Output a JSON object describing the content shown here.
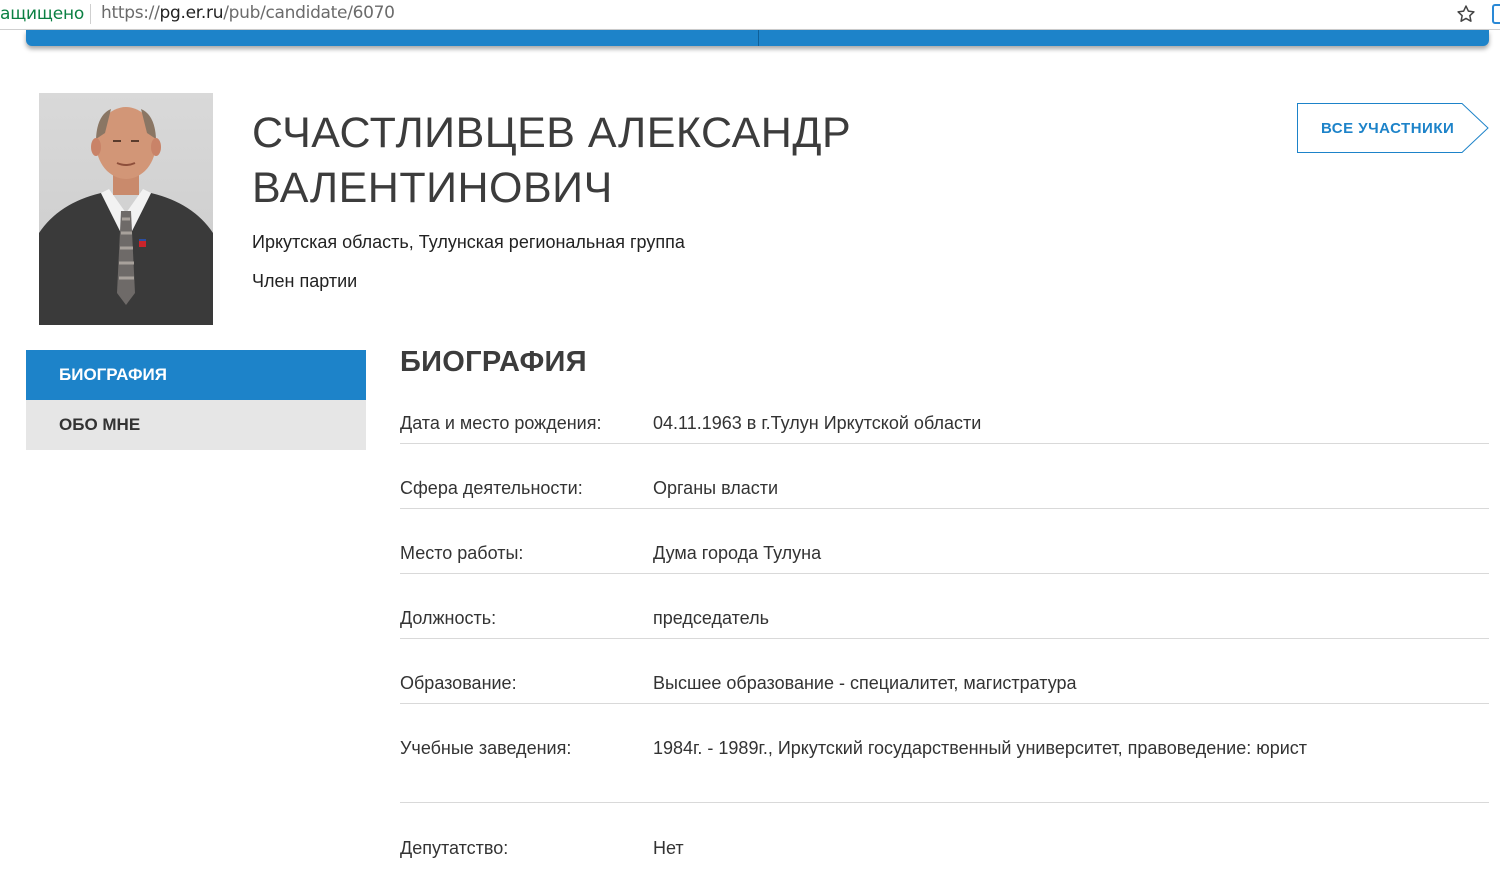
{
  "browser": {
    "secure_label": "ащищено",
    "url_scheme": "https://",
    "url_host": "pg.er.ru",
    "url_path": "/pub/candidate/6070"
  },
  "candidate": {
    "name_line1": "СЧАСТЛИВЦЕВ АЛЕКСАНДР",
    "name_line2": "ВАЛЕНТИНОВИЧ",
    "region": "Иркутская область, Тулунская региональная группа",
    "status": "Член партии"
  },
  "all_participants_button": "ВСЕ УЧАСТНИКИ",
  "tabs": [
    {
      "label": "БИОГРАФИЯ",
      "active": true
    },
    {
      "label": "ОБО МНЕ",
      "active": false
    }
  ],
  "biography": {
    "title": "БИОГРАФИЯ",
    "rows": [
      {
        "label": "Дата и место рождения:",
        "value": "04.11.1963 в г.Тулун Иркутской области"
      },
      {
        "label": "Сфера деятельности:",
        "value": "Органы власти"
      },
      {
        "label": "Место работы:",
        "value": "Дума города Тулуна"
      },
      {
        "label": "Должность:",
        "value": "председатель"
      },
      {
        "label": "Образование:",
        "value": "Высшее образование - специалитет, магистратура"
      },
      {
        "label": "Учебные заведения:",
        "value": "1984г. - 1989г., Иркутский государственный университет, правоведение: юрист"
      },
      {
        "label": "Депутатство:",
        "value": "Нет"
      }
    ]
  },
  "colors": {
    "accent": "#1d83c9",
    "tab_inactive_bg": "#e6e6e6",
    "secure_green": "#0b8043"
  },
  "icons": [
    "star-icon",
    "extension-icon"
  ]
}
